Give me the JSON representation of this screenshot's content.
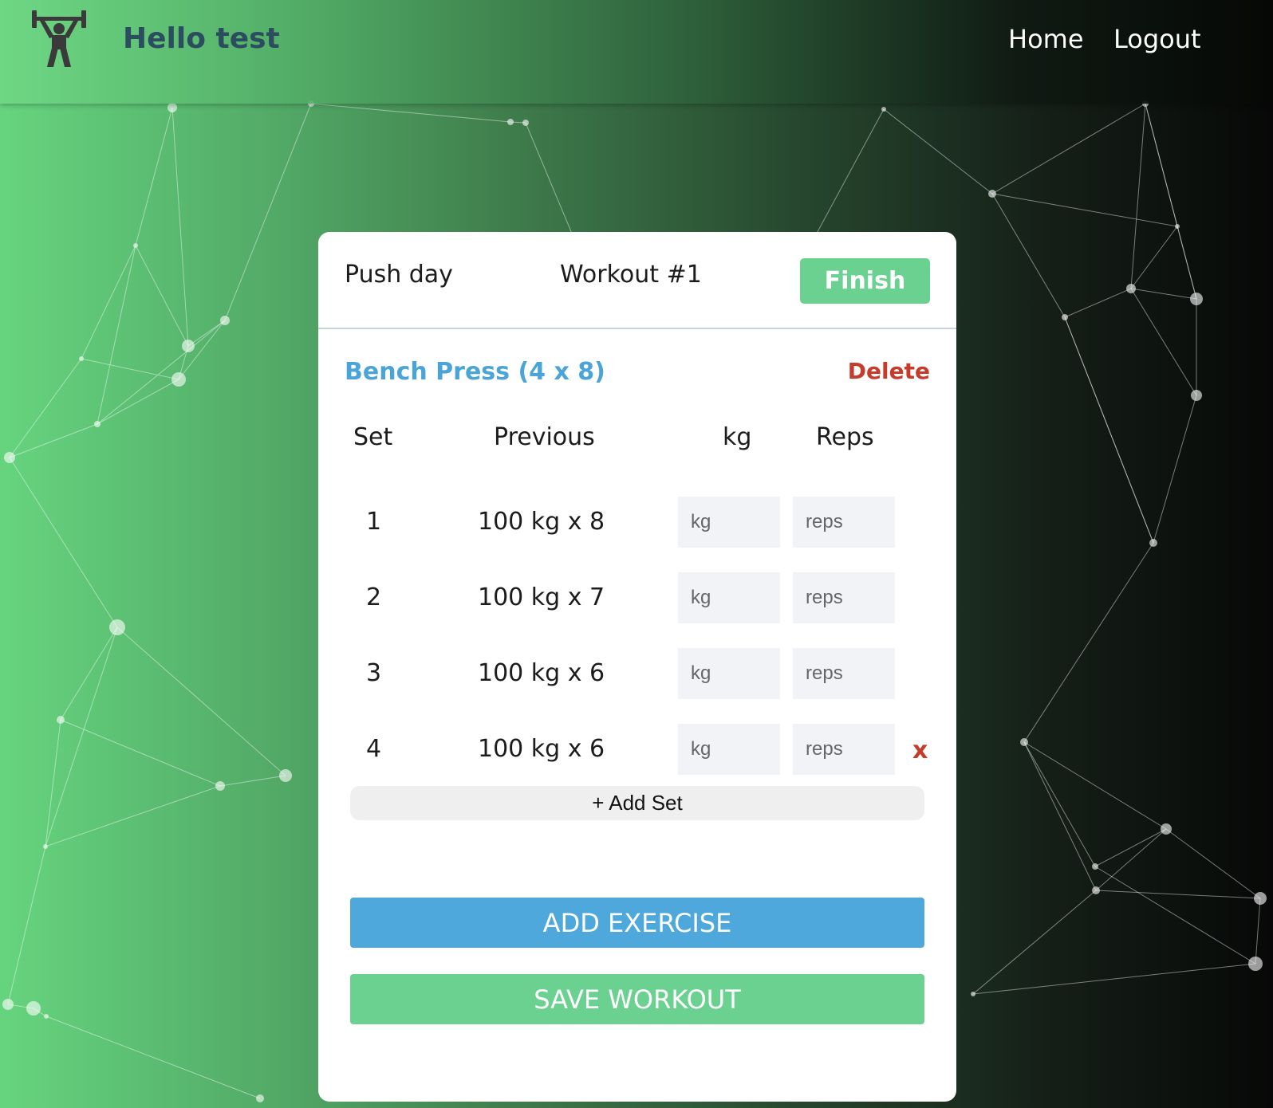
{
  "navbar": {
    "logo_icon": "weightlifter-icon",
    "greeting": "Hello test",
    "links": [
      "Home",
      "Logout"
    ]
  },
  "workout": {
    "name": "Push day",
    "number_label": "Workout #1",
    "finish_label": "Finish",
    "exercise": {
      "title": "Bench Press (4 x 8)",
      "delete_label": "Delete",
      "columns": [
        "Set",
        "Previous",
        "kg",
        "Reps"
      ],
      "sets": [
        {
          "num": "1",
          "previous": "100 kg x 8",
          "kg_placeholder": "kg",
          "reps_placeholder": "reps"
        },
        {
          "num": "2",
          "previous": "100 kg x 7",
          "kg_placeholder": "kg",
          "reps_placeholder": "reps"
        },
        {
          "num": "3",
          "previous": "100 kg x 6",
          "kg_placeholder": "kg",
          "reps_placeholder": "reps"
        },
        {
          "num": "4",
          "previous": "100 kg x 6",
          "kg_placeholder": "kg",
          "reps_placeholder": "reps",
          "remove_label": "x"
        }
      ],
      "add_set_label": "+ Add Set"
    },
    "add_exercise_label": "ADD EXERCISE",
    "save_workout_label": "SAVE WORKOUT"
  },
  "colors": {
    "green_button": "#6bd190",
    "blue_button": "#4ea8dc",
    "exercise_title": "#4aa4d8",
    "delete_red": "#c73b2a",
    "greeting_text": "#2c4d5f"
  }
}
